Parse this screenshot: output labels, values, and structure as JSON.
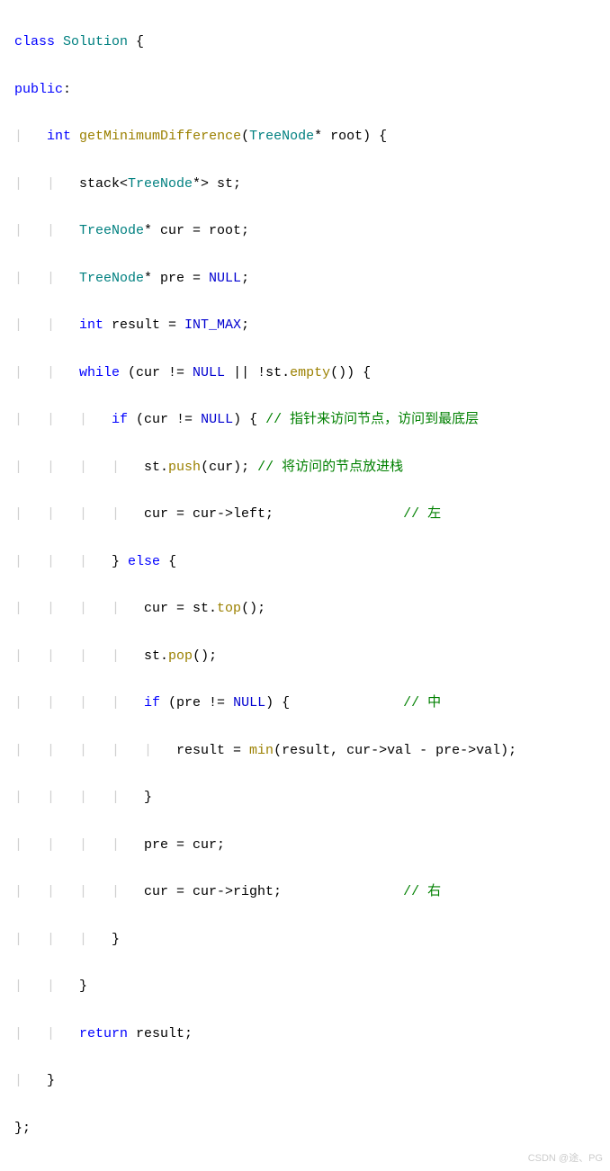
{
  "code": {
    "l1": {
      "kw": "class",
      "cls": "Solution",
      "p": " {"
    },
    "l2": {
      "kw": "public",
      "p": ":"
    },
    "l3": {
      "kw": "int",
      "fn": "getMinimumDifference",
      "p1": "(",
      "type": "TreeNode",
      "p2": "* root) {"
    },
    "l4": {
      "txt": "stack<",
      "type": "TreeNode",
      "txt2": "*> st;"
    },
    "l5": {
      "type": "TreeNode",
      "txt": "* cur = root;"
    },
    "l6": {
      "type": "TreeNode",
      "txt": "* pre = ",
      "const": "NULL",
      "p": ";"
    },
    "l7": {
      "kw": "int",
      "txt": " result = ",
      "const": "INT_MAX",
      "p": ";"
    },
    "l8": {
      "kw": "while",
      "p1": " (cur != ",
      "const": "NULL",
      "p2": " || !st.",
      "fn": "empty",
      "p3": "()) {"
    },
    "l9": {
      "kw": "if",
      "p1": " (cur != ",
      "const": "NULL",
      "p2": ") { ",
      "comment": "// 指针来访问节点，访问到最底层"
    },
    "l10": {
      "txt": "st.",
      "fn": "push",
      "p": "(cur); ",
      "comment": "// 将访问的节点放进栈"
    },
    "l11": {
      "txt": "cur = cur->left;                ",
      "comment": "// 左"
    },
    "l12": {
      "p1": "} ",
      "kw": "else",
      "p2": " {"
    },
    "l13": {
      "txt": "cur = st.",
      "fn": "top",
      "p": "();"
    },
    "l14": {
      "txt": "st.",
      "fn": "pop",
      "p": "();"
    },
    "l15": {
      "kw": "if",
      "p1": " (pre != ",
      "const": "NULL",
      "p2": ") {              ",
      "comment": "// 中"
    },
    "l16": {
      "txt": "result = ",
      "fn": "min",
      "p": "(result, cur->val - pre->val);"
    },
    "l17": {
      "p": "}"
    },
    "l18": {
      "txt": "pre = cur;"
    },
    "l19": {
      "txt": "cur = cur->right;               ",
      "comment": "// 右"
    },
    "l20": {
      "p": "}"
    },
    "l21": {
      "p": "}"
    },
    "l22": {
      "kw": "return",
      "txt": " result;"
    },
    "l23": {
      "p": "}"
    },
    "l24": {
      "p": "};"
    }
  },
  "watermark": "CSDN @途、PG"
}
